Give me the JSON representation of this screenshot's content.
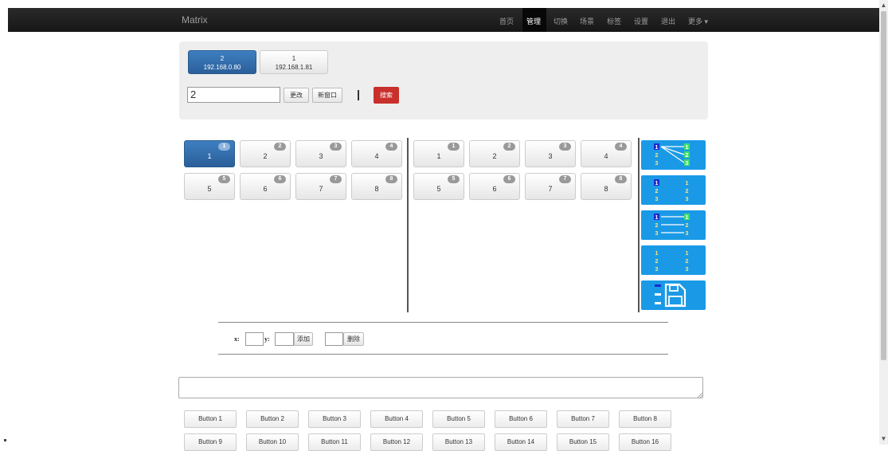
{
  "navbar": {
    "brand": "Matrix",
    "items": [
      "首页",
      "管理",
      "切换",
      "场景",
      "标签",
      "设置",
      "退出",
      "更多 ▾"
    ],
    "active": "管理"
  },
  "devices": [
    {
      "id": "2",
      "ip": "192.168.0.80",
      "active": true
    },
    {
      "id": "1",
      "ip": "192.168.1.81",
      "active": false
    }
  ],
  "name_input": {
    "value": "2"
  },
  "actions": {
    "rename": "更改",
    "new_window": "新窗口",
    "search": "搜索"
  },
  "inputs_grid": {
    "tiles": [
      {
        "label": "1",
        "badge": "1"
      },
      {
        "label": "2",
        "badge": "2"
      },
      {
        "label": "3",
        "badge": "3"
      },
      {
        "label": "4",
        "badge": "4"
      },
      {
        "label": "5",
        "badge": "5"
      },
      {
        "label": "6",
        "badge": "6"
      },
      {
        "label": "7",
        "badge": "7"
      },
      {
        "label": "8",
        "badge": "8"
      }
    ],
    "active_index": 0
  },
  "outputs_grid": {
    "tiles": [
      {
        "label": "1",
        "badge": "1"
      },
      {
        "label": "2",
        "badge": "2"
      },
      {
        "label": "3",
        "badge": "3"
      },
      {
        "label": "4",
        "badge": "4"
      },
      {
        "label": "5",
        "badge": "5"
      },
      {
        "label": "6",
        "badge": "6"
      },
      {
        "label": "7",
        "badge": "7"
      },
      {
        "label": "8",
        "badge": "8"
      }
    ]
  },
  "mode_buttons": [
    {
      "icon": "one-to-many-routing-icon",
      "numbers": [
        "1",
        "2",
        "3"
      ]
    },
    {
      "icon": "clear-routing-icon",
      "numbers": [
        "1",
        "2",
        "3"
      ]
    },
    {
      "icon": "one-to-one-routing-icon",
      "numbers": [
        "1",
        "2",
        "3"
      ]
    },
    {
      "icon": "numbered-grid-icon",
      "numbers": [
        "1",
        "2",
        "3"
      ]
    },
    {
      "icon": "save-scene-icon",
      "numbers": []
    }
  ],
  "xy_row": {
    "x_label": "x:",
    "y_label": "y:",
    "add": "添加",
    "delete": "删除"
  },
  "colors": {
    "accent": "#1a9ae6",
    "primary": "#2f6fad",
    "danger": "#c9302c",
    "nav": "#1b1b1b"
  },
  "buttons": [
    "Button 1",
    "Button 2",
    "Button 3",
    "Button 4",
    "Button 5",
    "Button 6",
    "Button 7",
    "Button 8",
    "Button 9",
    "Button 10",
    "Button 11",
    "Button 12",
    "Button 13",
    "Button 14",
    "Button 15",
    "Button 16"
  ]
}
